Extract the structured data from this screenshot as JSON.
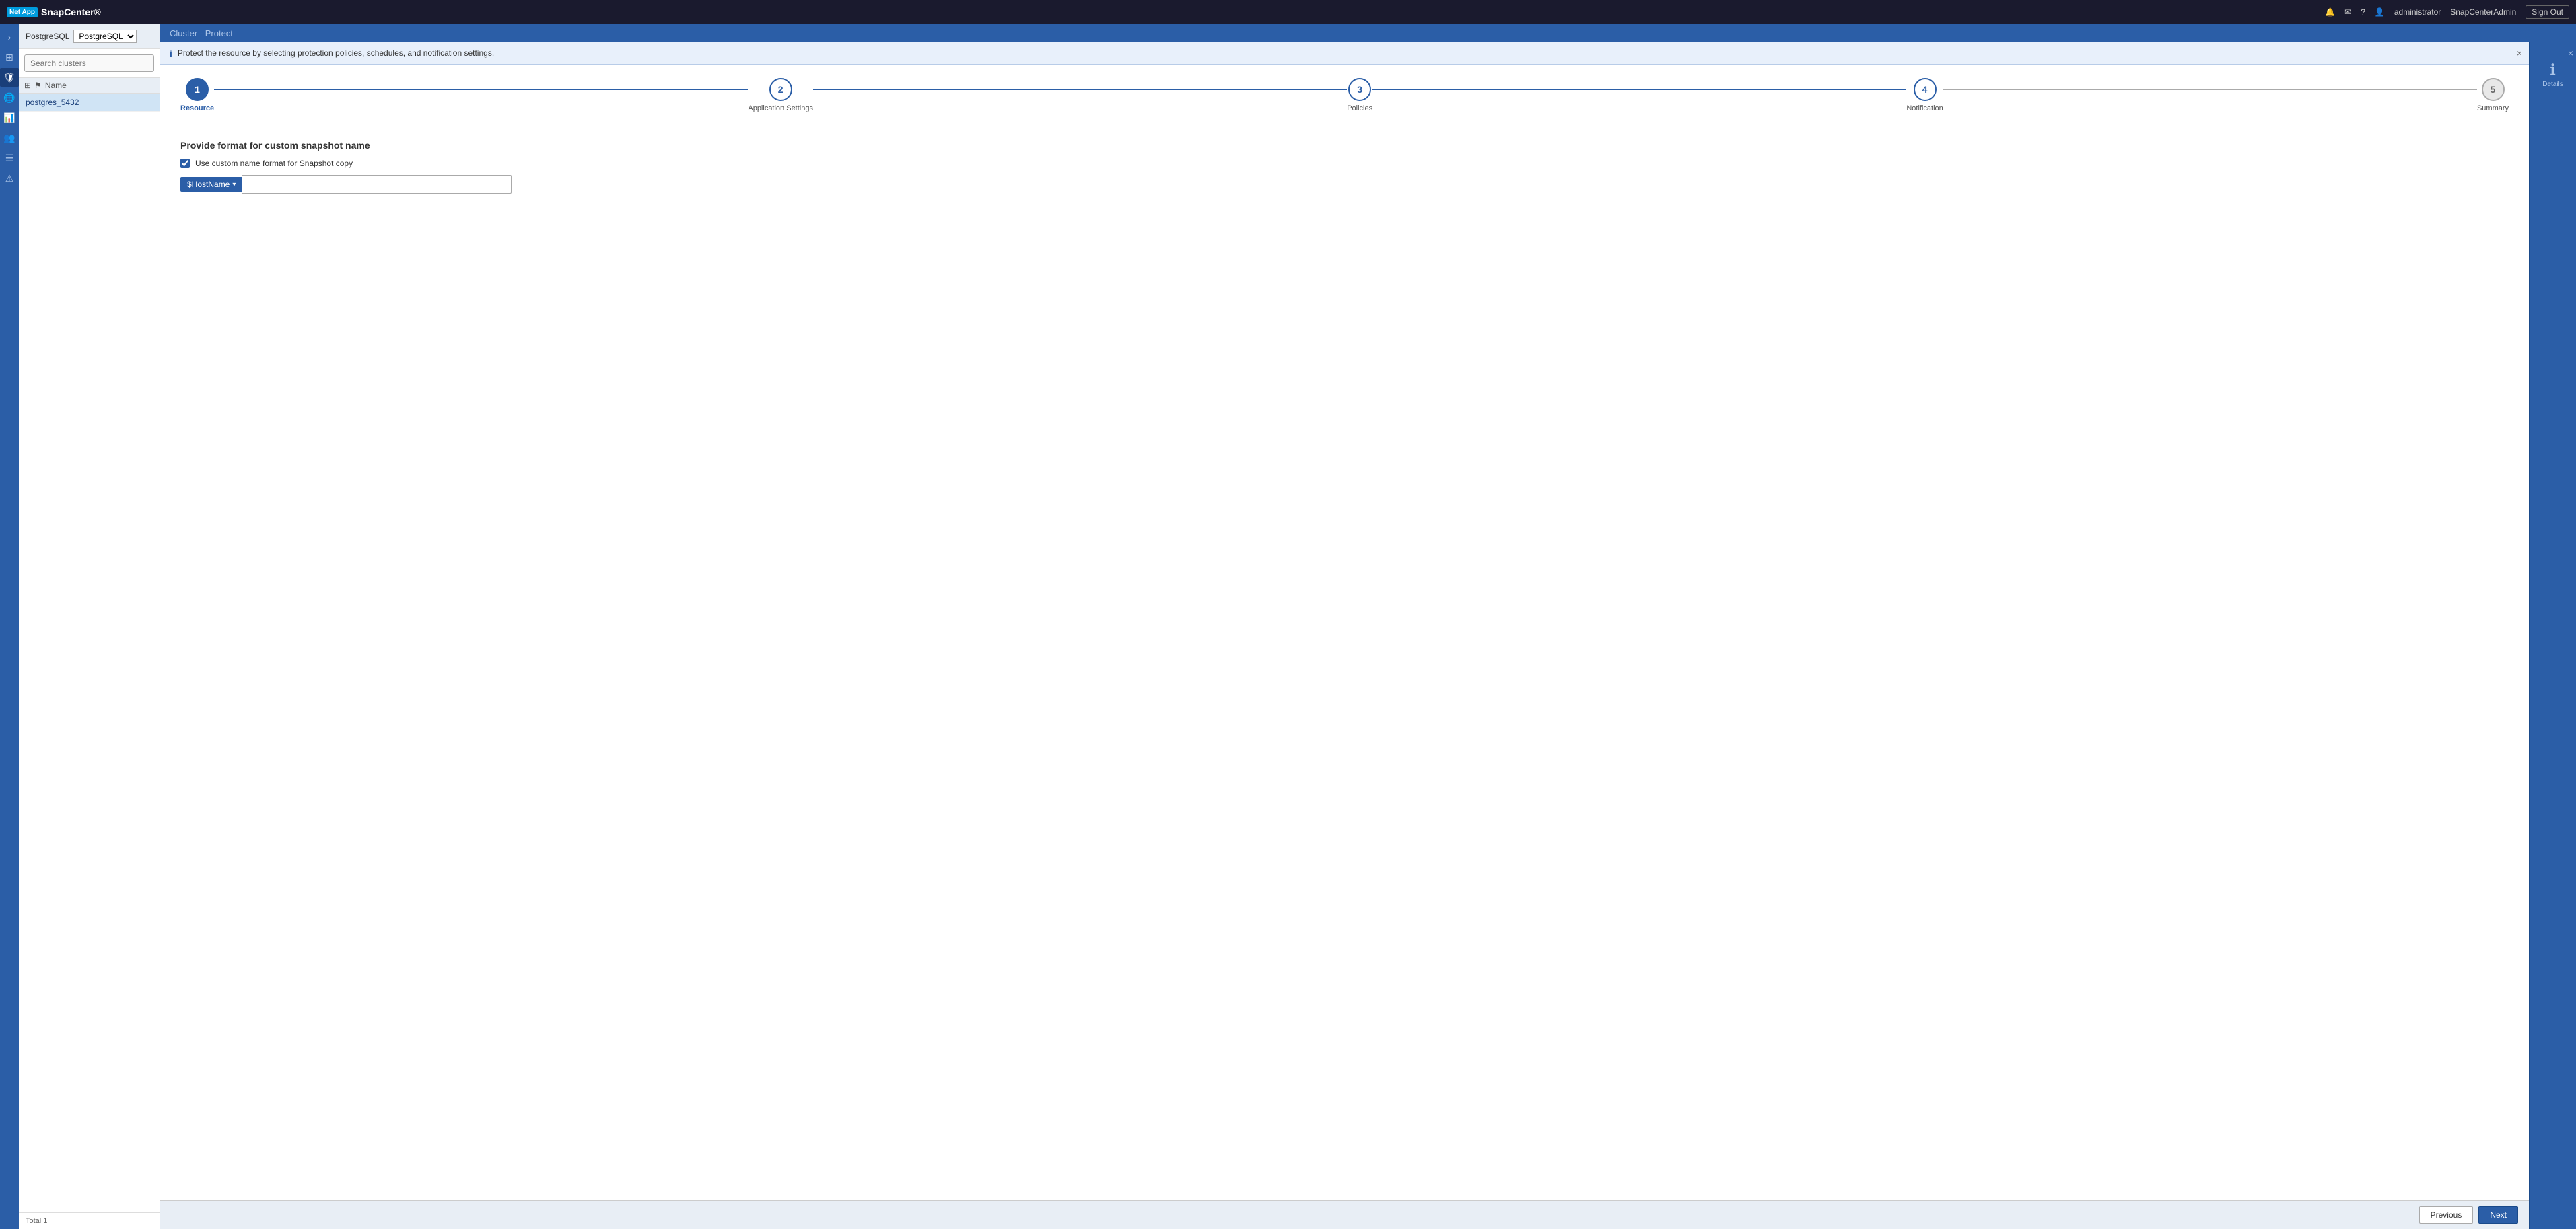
{
  "app": {
    "logo": "NetApp SnapCenter®",
    "logo_brand": "NetApp",
    "logo_app": "SnapCenter®"
  },
  "topnav": {
    "bell_icon": "🔔",
    "mail_icon": "✉",
    "help_icon": "?",
    "user_icon": "👤",
    "user_name": "administrator",
    "admin_label": "SnapCenterAdmin",
    "signout_label": "Sign Out"
  },
  "left_panel": {
    "db_label": "PostgreSQL",
    "search_placeholder": "Search clusters",
    "list_header": "Name",
    "items": [
      {
        "name": "postgres_5432",
        "selected": true
      }
    ],
    "footer_label": "Total 1"
  },
  "main": {
    "toolbar_prefix": "Cluster - ",
    "toolbar_title": "Protect"
  },
  "detail_panel": {
    "close_label": "×",
    "icon": "ℹ",
    "label": "Details"
  },
  "info_banner": {
    "icon": "i",
    "message": "Protect the resource by selecting protection policies, schedules, and notification settings.",
    "close": "×"
  },
  "wizard": {
    "steps": [
      {
        "number": "1",
        "label": "Resource",
        "state": "active"
      },
      {
        "number": "2",
        "label": "Application Settings",
        "state": "connected"
      },
      {
        "number": "3",
        "label": "Policies",
        "state": "connected"
      },
      {
        "number": "4",
        "label": "Notification",
        "state": "connected"
      },
      {
        "number": "5",
        "label": "Summary",
        "state": "normal"
      }
    ]
  },
  "form": {
    "section_title": "Provide format for custom snapshot name",
    "checkbox_label": "Use custom name format for Snapshot copy",
    "checkbox_checked": true,
    "snapshot_tag": "$HostName ▾",
    "snapshot_tag_label": "$HostName",
    "snapshot_input_value": ""
  },
  "footer": {
    "prev_label": "Previous",
    "next_label": "Next"
  },
  "icons": {
    "chevron_down": "▾",
    "grid_icon": "⊞",
    "shield_icon": "🛡",
    "globe_icon": "🌐",
    "chart_icon": "📊",
    "people_icon": "👥",
    "list_icon": "☰",
    "alert_icon": "⚠",
    "arrow_right": "›",
    "arrow_left": "‹",
    "table_icon": "⊞",
    "flag_icon": "⚑"
  }
}
